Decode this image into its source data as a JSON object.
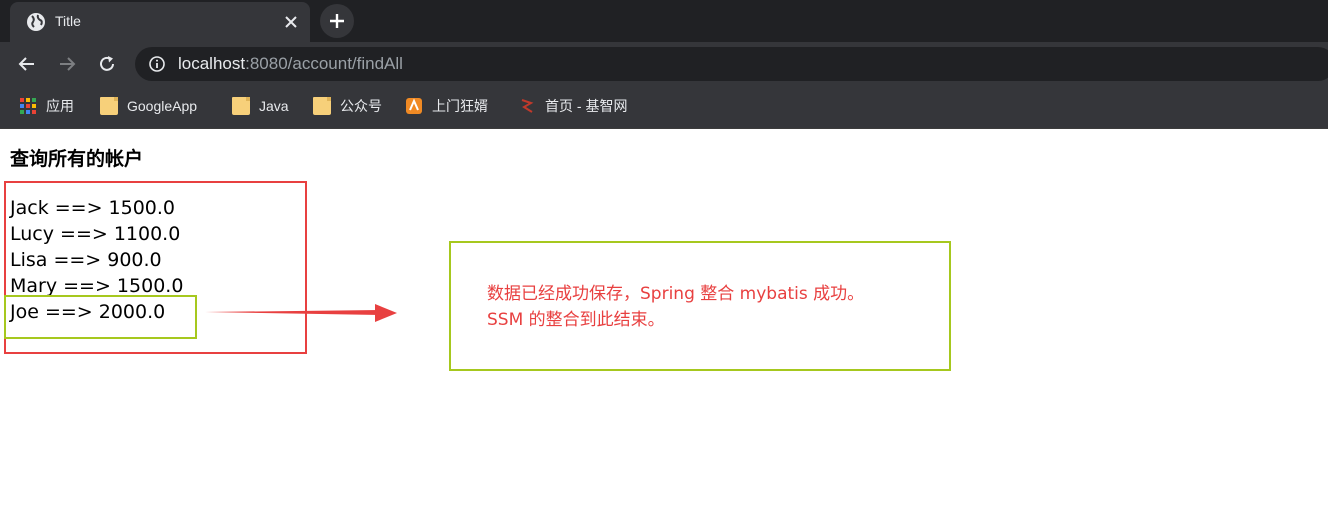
{
  "browser": {
    "tab": {
      "title": "Title"
    },
    "url": {
      "host": "localhost",
      "rest": ":8080/account/findAll"
    },
    "bookmarks": [
      {
        "label": "应用",
        "icon": "apps-grid-icon"
      },
      {
        "label": "GoogleApp",
        "icon": "folder-icon"
      },
      {
        "label": "Java",
        "icon": "folder-icon"
      },
      {
        "label": "公众号",
        "icon": "folder-icon"
      },
      {
        "label": "上门狂婿",
        "icon": "site-favicon-icon"
      },
      {
        "label": "首页 - 基智网",
        "icon": "site-favicon-icon"
      }
    ]
  },
  "page": {
    "title": "查询所有的帐户",
    "accounts": [
      {
        "text": "Jack ==> 1500.0"
      },
      {
        "text": "Lucy ==> 1100.0"
      },
      {
        "text": "Lisa ==> 900.0"
      },
      {
        "text": "Mary ==> 1500.0"
      },
      {
        "text": "Joe ==> 2000.0"
      }
    ]
  },
  "annotation": {
    "line1": "数据已经成功保存，Spring 整合 mybatis 成功。",
    "line2": "SSM 的整合到此结束。"
  },
  "colors": {
    "red_annotation": "#e84040",
    "green_annotation": "#a6c81e",
    "chrome_dark": "#202124",
    "chrome_toolbar": "#35363a"
  }
}
